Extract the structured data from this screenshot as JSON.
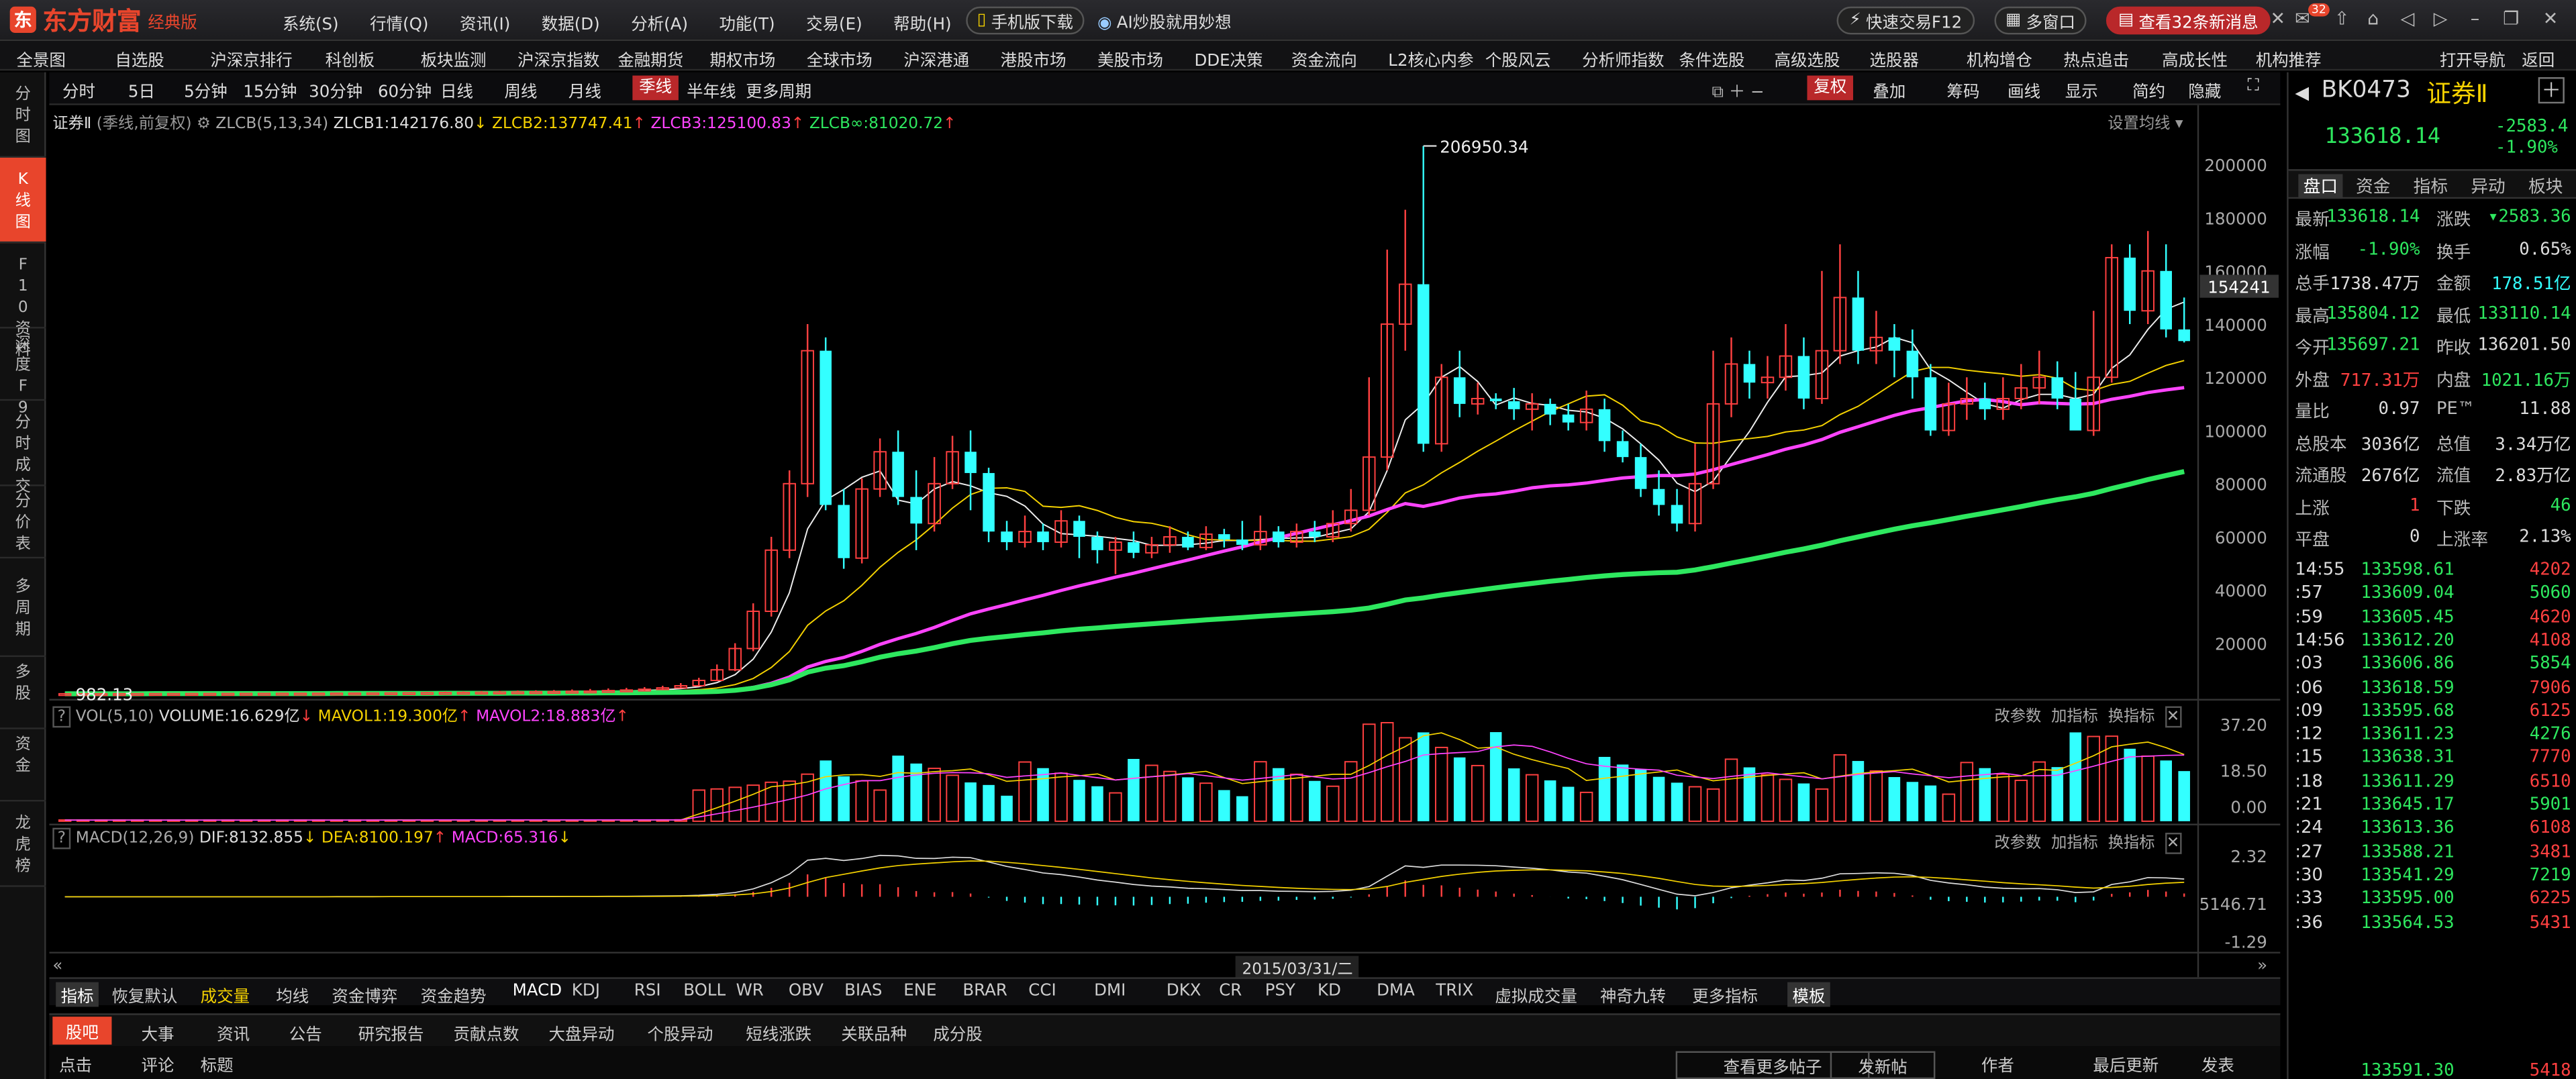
{
  "app": {
    "logo": "东方财富",
    "edition": "经典版"
  },
  "topmenu": [
    "系统(S)",
    "行情(Q)",
    "资讯(I)",
    "数据(D)",
    "分析(A)",
    "功能(T)",
    "交易(E)",
    "帮助(H)"
  ],
  "top_right": {
    "mobile": "手机版下载",
    "ai": "AI炒股就用妙想",
    "quick_trade": "快速交易F12",
    "multi_window": "多窗口",
    "news": "查看32条新消息",
    "news_badge": "32"
  },
  "menubar": [
    "全景图",
    "自选股",
    "沪深京排行",
    "科创板",
    "板块监测",
    "沪深京指数",
    "金融期货",
    "期权市场",
    "全球市场",
    "沪深港通",
    "港股市场",
    "美股市场",
    "DDE决策",
    "资金流向",
    "L2核心内参",
    "个股风云",
    "分析师指数",
    "条件选股",
    "高级选股",
    "选股器",
    "机构增仓",
    "热点追击",
    "高成长性",
    "机构推荐",
    "打开导航",
    "返回"
  ],
  "leftbar": [
    {
      "label": "分时图"
    },
    {
      "label": "K线图",
      "active": true
    },
    {
      "label": "F10资料"
    },
    {
      "label": "深度F9"
    },
    {
      "label": "分时成交"
    },
    {
      "label": "分价表"
    },
    {
      "label": "多周期"
    },
    {
      "label": "多股"
    },
    {
      "label": "资金"
    },
    {
      "label": "龙虎榜"
    }
  ],
  "periods": [
    "分时",
    "5日",
    "5分钟",
    "15分钟",
    "30分钟",
    "60分钟",
    "日线",
    "周线",
    "月线",
    "季线",
    "半年线",
    "更多周期"
  ],
  "active_period": "季线",
  "toolbar_right": [
    "复权",
    "叠加",
    "筹码",
    "画线",
    "显示",
    "简约",
    "隐藏"
  ],
  "main_legend": {
    "name": "证券Ⅱ",
    "mode": "(季线,前复权)",
    "ind": "ZLCB(5,13,34)",
    "v1": "ZLCB1:142176.80",
    "v2": "ZLCB2:137747.41",
    "v3": "ZLCB3:125100.83",
    "v4": "ZLCB∞:81020.72",
    "settings": "设置均线"
  },
  "vol_legend": {
    "name": "VOL(5,10)",
    "v1": "VOLUME:16.629亿",
    "v2": "MAVOL1:19.300亿",
    "v3": "MAVOL2:18.883亿"
  },
  "macd_legend": {
    "name": "MACD(12,26,9)",
    "v1": "DIF:8132.855",
    "v2": "DEA:8100.197",
    "v3": "MACD:65.316"
  },
  "panel_btns": [
    "改参数",
    "加指标",
    "换指标"
  ],
  "price_labels": [
    "200000",
    "180000",
    "160000",
    "140000",
    "120000",
    "100000",
    "80000",
    "60000",
    "40000",
    "20000"
  ],
  "current_price_tag": "154241",
  "high_mark": "206950.34",
  "low_mark": "982.13",
  "vol_axis": [
    "37.20",
    "18.50",
    "0.00"
  ],
  "macd_axis": [
    "2.32",
    "5146.71",
    "-1.29"
  ],
  "date_cursor": "2015/03/31/二",
  "subtabs": [
    "指标",
    "恢复默认",
    "成交量",
    "均线",
    "资金博弈",
    "资金趋势",
    "MACD",
    "KDJ",
    "RSI",
    "BOLL",
    "WR",
    "OBV",
    "BIAS",
    "ENE",
    "BRAR",
    "CCI",
    "DMI",
    "DKX",
    "CR",
    "PSY",
    "KD",
    "DMA",
    "TRIX",
    "虚拟成交量",
    "神奇九转",
    "更多指标",
    "模板"
  ],
  "guba_tabs": [
    "股吧",
    "大事",
    "资讯",
    "公告",
    "研究报告",
    "贡献点数",
    "大盘异动",
    "个股异动",
    "短线涨跌",
    "关联品种",
    "成分股"
  ],
  "footer": {
    "c1": "点击",
    "c2": "评论",
    "c3": "标题",
    "more": "查看更多帖子",
    "post": "发新帖",
    "author": "作者",
    "latest": "最后更新",
    "post_time": "发表"
  },
  "right": {
    "code": "BK0473",
    "name": "证券Ⅱ",
    "price": "133618.14",
    "change": "-2583.4",
    "pct": "-1.90%",
    "tabs": [
      "盘口",
      "资金",
      "指标",
      "异动",
      "板块"
    ],
    "quote": [
      [
        "最新",
        "133618.14",
        "涨跌",
        "▾2583.36"
      ],
      [
        "涨幅",
        "-1.90%",
        "换手",
        "0.65%"
      ],
      [
        "总手",
        "1738.47万",
        "金额",
        "178.51亿"
      ],
      [
        "最高",
        "135804.12",
        "最低",
        "133110.14"
      ],
      [
        "今开",
        "135697.21",
        "昨收",
        "136201.50"
      ],
      [
        "外盘",
        "717.31万",
        "内盘",
        "1021.16万"
      ],
      [
        "量比",
        "0.97",
        "PE™",
        "11.88"
      ],
      [
        "总股本",
        "3036亿",
        "总值",
        "3.34万亿"
      ],
      [
        "流通股",
        "2676亿",
        "流值",
        "2.83万亿"
      ],
      [
        "上涨",
        "1",
        "下跌",
        "46"
      ],
      [
        "平盘",
        "0",
        "上涨率",
        "2.13%"
      ]
    ],
    "ticks": [
      [
        "14:55",
        "133598.61",
        "4202"
      ],
      [
        ":57",
        "133609.04",
        "5060"
      ],
      [
        ":59",
        "133605.45",
        "4620"
      ],
      [
        "14:56",
        "133612.20",
        "4108"
      ],
      [
        ":03",
        "133606.86",
        "5854"
      ],
      [
        ":06",
        "133618.59",
        "7906"
      ],
      [
        ":09",
        "133595.68",
        "6125"
      ],
      [
        ":12",
        "133611.23",
        "4276"
      ],
      [
        ":15",
        "133638.31",
        "7770"
      ],
      [
        ":18",
        "133611.29",
        "6510"
      ],
      [
        ":21",
        "133645.17",
        "5901"
      ],
      [
        ":24",
        "133613.36",
        "6108"
      ],
      [
        ":27",
        "133588.21",
        "3481"
      ],
      [
        ":30",
        "133541.29",
        "7219"
      ],
      [
        ":33",
        "133595.00",
        "6225"
      ],
      [
        ":36",
        "133564.53",
        "5431"
      ]
    ],
    "last_tick": [
      "",
      "133591.30",
      "5418"
    ]
  },
  "chart_data": {
    "type": "candlestick",
    "period": "quarterly",
    "ylim": [
      0,
      210000
    ],
    "candles": [
      [
        1000,
        1000,
        980,
        1020
      ],
      [
        1000,
        1010,
        990,
        1030
      ],
      [
        1010,
        1010,
        1000,
        1030
      ],
      [
        1010,
        1030,
        1000,
        1050
      ],
      [
        1030,
        1040,
        1020,
        1060
      ],
      [
        1040,
        1050,
        1030,
        1080
      ],
      [
        1050,
        1060,
        1040,
        1090
      ],
      [
        1060,
        1070,
        1050,
        1100
      ],
      [
        1070,
        1090,
        1060,
        1120
      ],
      [
        1090,
        1100,
        1080,
        1140
      ],
      [
        1100,
        1120,
        1090,
        1160
      ],
      [
        1120,
        1130,
        1110,
        1200
      ],
      [
        1130,
        1150,
        1120,
        1220
      ],
      [
        1150,
        1160,
        1140,
        1240
      ],
      [
        1160,
        1180,
        1150,
        1260
      ],
      [
        1180,
        1200,
        1170,
        1300
      ],
      [
        1200,
        1230,
        1190,
        1350
      ],
      [
        1230,
        1260,
        1220,
        1400
      ],
      [
        1260,
        1300,
        1250,
        1500
      ],
      [
        1300,
        1350,
        1280,
        1600
      ],
      [
        1350,
        1400,
        1330,
        1700
      ],
      [
        1400,
        1450,
        1380,
        1800
      ],
      [
        1450,
        1500,
        1430,
        1900
      ],
      [
        1500,
        1550,
        1480,
        2000
      ],
      [
        1550,
        1600,
        1530,
        2100
      ],
      [
        1600,
        1650,
        1580,
        2200
      ],
      [
        1650,
        1700,
        1630,
        2300
      ],
      [
        1700,
        1800,
        1680,
        2400
      ],
      [
        1800,
        1900,
        1780,
        2600
      ],
      [
        1900,
        2000,
        1880,
        2800
      ],
      [
        2000,
        2200,
        1980,
        3000
      ],
      [
        2200,
        2400,
        2150,
        3200
      ],
      [
        2400,
        2700,
        2300,
        3500
      ],
      [
        2700,
        3200,
        2600,
        4000
      ],
      [
        3200,
        4000,
        3100,
        5000
      ],
      [
        4000,
        6000,
        3900,
        7000
      ],
      [
        6000,
        10000,
        5800,
        12000
      ],
      [
        10000,
        18000,
        9500,
        20000
      ],
      [
        18000,
        32000,
        17000,
        35000
      ],
      [
        32000,
        55000,
        30000,
        60000
      ],
      [
        55000,
        80000,
        52000,
        85000
      ],
      [
        80000,
        130000,
        75000,
        140000
      ],
      [
        130000,
        72000,
        70000,
        135000
      ],
      [
        72000,
        52000,
        48000,
        78000
      ],
      [
        52000,
        78000,
        50000,
        82000
      ],
      [
        78000,
        92000,
        75000,
        97000
      ],
      [
        92000,
        75000,
        72000,
        100000
      ],
      [
        75000,
        65000,
        55000,
        85000
      ],
      [
        65000,
        80000,
        62000,
        90000
      ],
      [
        80000,
        92000,
        78000,
        98000
      ],
      [
        92000,
        84000,
        70000,
        100000
      ],
      [
        84000,
        62000,
        58000,
        86000
      ],
      [
        62000,
        58000,
        55000,
        66000
      ],
      [
        58000,
        62000,
        56000,
        68000
      ],
      [
        62000,
        58000,
        55000,
        65000
      ],
      [
        58000,
        66000,
        56000,
        70000
      ],
      [
        66000,
        60000,
        52000,
        68000
      ],
      [
        60000,
        55000,
        50000,
        62000
      ],
      [
        55000,
        58000,
        46000,
        60000
      ],
      [
        58000,
        54000,
        52000,
        62000
      ],
      [
        54000,
        57000,
        52000,
        60000
      ],
      [
        57000,
        60000,
        54000,
        64000
      ],
      [
        60000,
        56000,
        55000,
        62000
      ],
      [
        56000,
        61000,
        55000,
        64000
      ],
      [
        61000,
        59000,
        56000,
        63000
      ],
      [
        59000,
        57000,
        55000,
        66000
      ],
      [
        57000,
        62000,
        55000,
        68000
      ],
      [
        62000,
        58000,
        56000,
        64000
      ],
      [
        58000,
        62000,
        56000,
        65000
      ],
      [
        62000,
        60000,
        58000,
        66000
      ],
      [
        60000,
        65000,
        58000,
        70000
      ],
      [
        65000,
        70000,
        62000,
        78000
      ],
      [
        70000,
        90000,
        68000,
        120000
      ],
      [
        90000,
        140000,
        85000,
        168000
      ],
      [
        140000,
        155000,
        130000,
        183000
      ],
      [
        155000,
        95000,
        92000,
        207000
      ],
      [
        95000,
        120000,
        92000,
        125000
      ],
      [
        120000,
        110000,
        105000,
        130000
      ],
      [
        110000,
        112000,
        106000,
        118000
      ],
      [
        112000,
        111000,
        108000,
        114000
      ],
      [
        111000,
        108000,
        104000,
        116000
      ],
      [
        108000,
        110000,
        100000,
        114000
      ],
      [
        110000,
        106000,
        102000,
        112000
      ],
      [
        106000,
        103000,
        100000,
        110000
      ],
      [
        103000,
        108000,
        100000,
        115000
      ],
      [
        108000,
        96000,
        92000,
        112000
      ],
      [
        96000,
        90000,
        88000,
        100000
      ],
      [
        90000,
        78000,
        75000,
        95000
      ],
      [
        78000,
        72000,
        68000,
        85000
      ],
      [
        72000,
        65000,
        62000,
        78000
      ],
      [
        65000,
        80000,
        62000,
        95000
      ],
      [
        80000,
        110000,
        78000,
        130000
      ],
      [
        110000,
        125000,
        105000,
        135000
      ],
      [
        125000,
        118000,
        112000,
        130000
      ],
      [
        118000,
        120000,
        112000,
        128000
      ],
      [
        120000,
        128000,
        115000,
        140000
      ],
      [
        128000,
        112000,
        108000,
        135000
      ],
      [
        112000,
        130000,
        110000,
        160000
      ],
      [
        130000,
        150000,
        125000,
        170000
      ],
      [
        150000,
        130000,
        125000,
        160000
      ],
      [
        130000,
        135000,
        125000,
        145000
      ],
      [
        135000,
        130000,
        120000,
        140000
      ],
      [
        130000,
        120000,
        112000,
        138000
      ],
      [
        120000,
        100000,
        98000,
        125000
      ],
      [
        100000,
        110000,
        98000,
        118000
      ],
      [
        110000,
        112000,
        104000,
        120000
      ],
      [
        112000,
        108000,
        104000,
        118000
      ],
      [
        108000,
        112000,
        104000,
        120000
      ],
      [
        112000,
        116000,
        108000,
        125000
      ],
      [
        116000,
        120000,
        110000,
        130000
      ],
      [
        120000,
        112000,
        108000,
        126000
      ],
      [
        112000,
        100000,
        100000,
        122000
      ],
      [
        100000,
        120000,
        98000,
        145000
      ],
      [
        120000,
        165000,
        118000,
        170000
      ],
      [
        165000,
        145000,
        140000,
        170000
      ],
      [
        145000,
        160000,
        140000,
        175000
      ],
      [
        160000,
        138000,
        135000,
        170000
      ],
      [
        138000,
        133618,
        133110,
        150000
      ]
    ],
    "series": [
      {
        "name": "ZLCB1",
        "color": "#eeeeee",
        "last": 142176.8
      },
      {
        "name": "ZLCB2",
        "color": "#f5d200",
        "last": 137747.41
      },
      {
        "name": "ZLCB3",
        "color": "#ff44ff",
        "last": 125100.83
      },
      {
        "name": "ZLCB∞",
        "color": "#2ee85f",
        "last": 81020.72
      }
    ]
  }
}
